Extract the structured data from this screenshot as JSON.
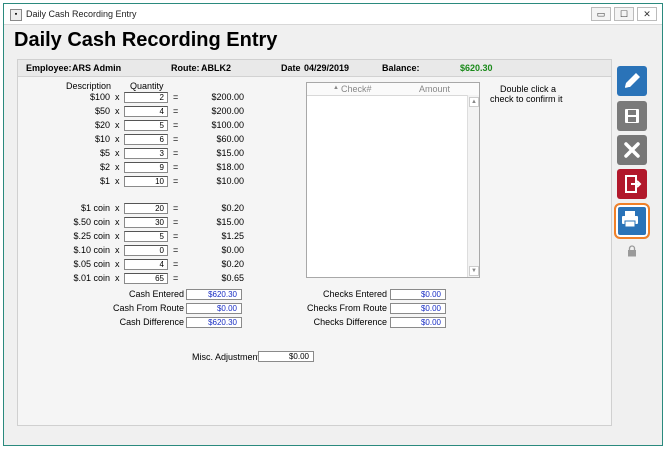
{
  "window": {
    "title": "Daily Cash Recording Entry",
    "minimize_glyph": "▭",
    "maximize_glyph": "☐",
    "close_glyph": "✕"
  },
  "heading": "Daily Cash Recording Entry",
  "info": {
    "employee_label": "Employee:",
    "employee_value": "ARS Admin",
    "route_label": "Route:",
    "route_value": "ABLK2",
    "date_label": "Date",
    "date_value": "04/29/2019",
    "balance_label": "Balance:",
    "balance_value": "$620.30",
    "balance_color": "#1a8a1a"
  },
  "denominations_header": {
    "description": "Description",
    "quantity": "Quantity"
  },
  "bills": [
    {
      "desc": "$100",
      "qty": "2",
      "total": "$200.00"
    },
    {
      "desc": "$50",
      "qty": "4",
      "total": "$200.00"
    },
    {
      "desc": "$20",
      "qty": "5",
      "total": "$100.00"
    },
    {
      "desc": "$10",
      "qty": "6",
      "total": "$60.00"
    },
    {
      "desc": "$5",
      "qty": "3",
      "total": "$15.00"
    },
    {
      "desc": "$2",
      "qty": "9",
      "total": "$18.00"
    },
    {
      "desc": "$1",
      "qty": "10",
      "total": "$10.00"
    }
  ],
  "coins": [
    {
      "desc": "$1 coin",
      "qty": "20",
      "total": "$0.20"
    },
    {
      "desc": "$.50 coin",
      "qty": "30",
      "total": "$15.00"
    },
    {
      "desc": "$.25 coin",
      "qty": "5",
      "total": "$1.25"
    },
    {
      "desc": "$.10 coin",
      "qty": "0",
      "total": "$0.00"
    },
    {
      "desc": "$.05 coin",
      "qty": "4",
      "total": "$0.20"
    },
    {
      "desc": "$.01 coin",
      "qty": "65",
      "total": "$0.65"
    }
  ],
  "symbols": {
    "times": "x",
    "equals": "="
  },
  "cash_totals": [
    {
      "label": "Cash Entered",
      "value": "$620.30"
    },
    {
      "label": "Cash From Route",
      "value": "$0.00"
    },
    {
      "label": "Cash Difference",
      "value": "$620.30"
    }
  ],
  "check_totals": [
    {
      "label": "Checks Entered",
      "value": "$0.00"
    },
    {
      "label": "Checks From Route",
      "value": "$0.00"
    },
    {
      "label": "Checks Difference",
      "value": "$0.00"
    }
  ],
  "misc": {
    "label": "Misc. Adjustment",
    "value": "$0.00"
  },
  "checks_grid": {
    "col_check": "Check#",
    "col_amount": "Amount",
    "sort_glyph": "▲",
    "scroll_up": "▲",
    "scroll_down": "▼"
  },
  "checks_hint": {
    "line1": "Double click a",
    "line2": "check to confirm it"
  },
  "sidebar": [
    "pencil-icon",
    "floppy-disk-icon",
    "x-icon",
    "exit-door-icon",
    "printer-icon",
    "lock-icon"
  ]
}
